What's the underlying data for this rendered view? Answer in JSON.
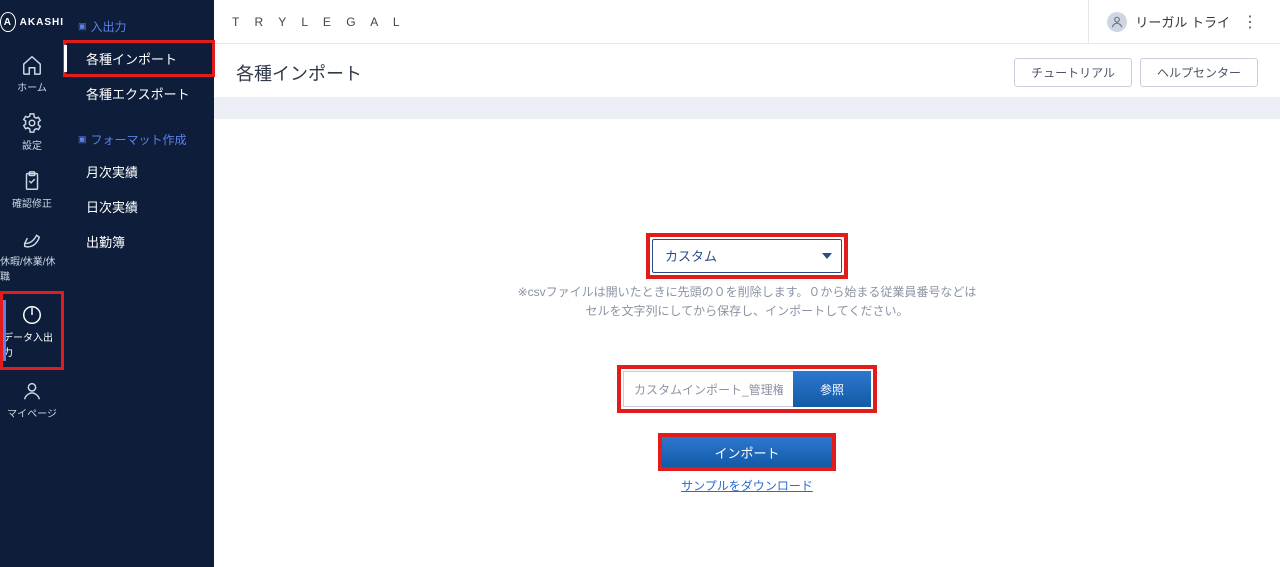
{
  "logo": "AKASHI",
  "brand": "T R Y L E G A L",
  "user_name": "リーガル トライ",
  "nav": [
    {
      "key": "home",
      "label": "ホーム"
    },
    {
      "key": "settings",
      "label": "設定"
    },
    {
      "key": "confirm",
      "label": "確認修正"
    },
    {
      "key": "leave",
      "label": "休暇/休業/休職"
    },
    {
      "key": "io",
      "label": "データ入出力"
    },
    {
      "key": "mypage",
      "label": "マイページ"
    }
  ],
  "sidebar": {
    "group1_title": "入出力",
    "group1_items": [
      "各種インポート",
      "各種エクスポート"
    ],
    "group2_title": "フォーマット作成",
    "group2_items": [
      "月次実績",
      "日次実績",
      "出勤簿"
    ]
  },
  "page": {
    "title": "各種インポート",
    "btn_tutorial": "チュートリアル",
    "btn_help": "ヘルプセンター"
  },
  "form": {
    "select_value": "カスタム",
    "hint_line1": "※csvファイルは開いたときに先頭の０を削除します。０から始まる従業員番号などは",
    "hint_line2": "セルを文字列にしてから保存し、インポートしてください。",
    "file_placeholder": "カスタムインポート_管理権限",
    "browse_label": "参照",
    "import_label": "インポート",
    "sample_link": "サンプルをダウンロード"
  }
}
